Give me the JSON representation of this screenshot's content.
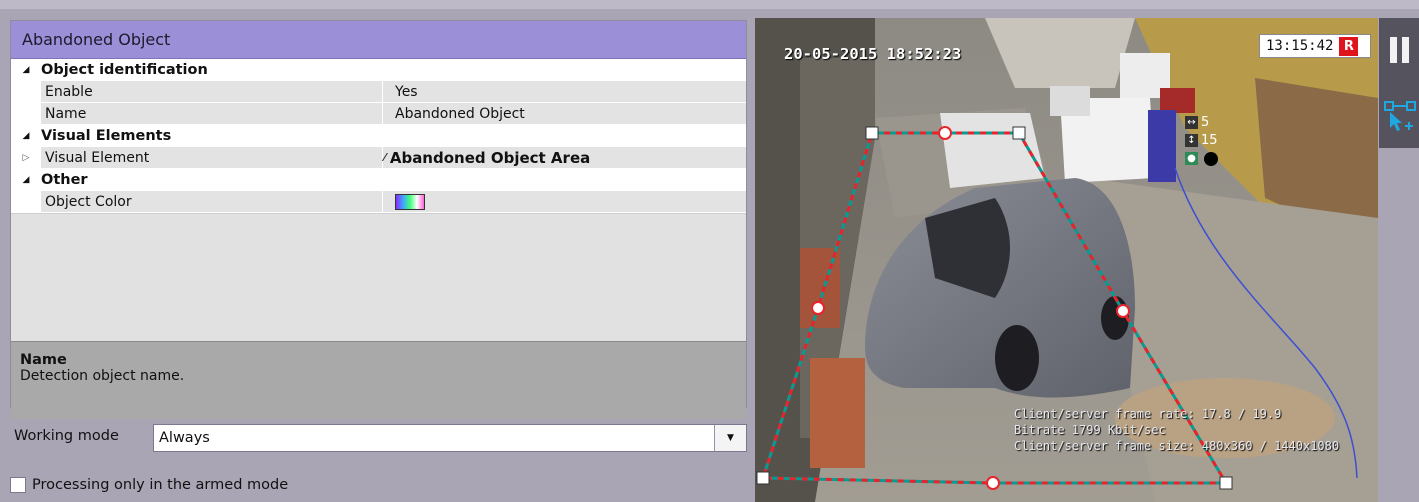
{
  "panel": {
    "title": "Abandoned Object",
    "sections": [
      {
        "label": "Object identification",
        "props": [
          {
            "key": "Enable",
            "value": "Yes"
          },
          {
            "key": "Name",
            "value": "Abandoned Object"
          }
        ]
      },
      {
        "label": "Visual Elements",
        "props": [
          {
            "key": "Visual Element",
            "value": "Abandoned Object Area"
          }
        ]
      },
      {
        "label": "Other",
        "props": [
          {
            "key": "Object Color",
            "value": ""
          }
        ]
      }
    ],
    "description": {
      "title": "Name",
      "text": "Detection object name."
    }
  },
  "working_mode": {
    "label": "Working mode",
    "value": "Always"
  },
  "armed_checkbox": {
    "label": "Processing only in the armed mode",
    "checked": false
  },
  "video": {
    "osd_date": "20-05-2015 18:52:23",
    "clock": "13:15:42",
    "rec_badge": "R",
    "stats": [
      "Client/server frame rate: 17.8 / 19.9",
      "Bitrate 1799 Kbit/sec",
      "Client/server frame size: 480x360 / 1440x1080"
    ],
    "meta_width": "5",
    "meta_height": "15",
    "zone_color": "#e8232a"
  },
  "icons": [
    "expand-triangle-icon",
    "collapse-triangle-icon",
    "edit-pen-icon",
    "dropdown-arrow-icon",
    "pause-icon",
    "add-visual-element-icon"
  ]
}
